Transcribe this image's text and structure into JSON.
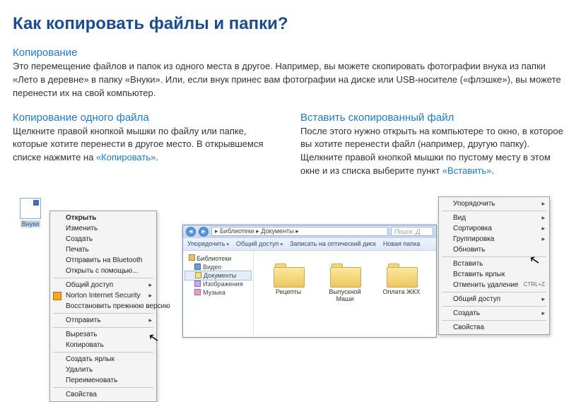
{
  "title": "Как копировать файлы и папки?",
  "section_copy": {
    "head": "Копирование",
    "p1": "Это перемещение файлов и папок из одного места в другое. Например, вы можете скопировать фотографии внука из папки «Лето в деревне» в папку «Внуки». Или, если внук принес вам фотографии на диске или USB-носителе («флэшке»), вы можете перенести их на свой компьютер."
  },
  "section_one": {
    "head": "Копирование одного файла",
    "p_before": "Щелкните правой кнопкой мышки по файлу или папке, которые хотите перенести в другое место. В открывшемся списке нажмите на ",
    "link": "«Копировать»",
    "p_after": "."
  },
  "section_paste": {
    "head": "Вставить скопированный файл",
    "p_before": "После этого нужно открыть на компьютере то окно, в которое вы хотите перенести файл (например, другую папку). Щелкните правой кнопкой мышки по пустому месту в этом окне и из списка выберите пункт ",
    "link": "«Вставить»",
    "p_after": "."
  },
  "fig1": {
    "icon_label": "Внуки",
    "menu": {
      "open": "Открыть",
      "edit": "Изменить",
      "create": "Создать",
      "print": "Печать",
      "bluetooth": "Отправить на Bluetooth",
      "openwith": "Открыть с помощью...",
      "share": "Общий доступ",
      "norton": "Norton Internet Security",
      "restore": "Восстановить прежнюю версию",
      "send": "Отправить",
      "cut": "Вырезать",
      "copy": "Копировать",
      "shortcut": "Создать ярлык",
      "delete": "Удалить",
      "rename": "Переименовать",
      "props": "Свойства"
    }
  },
  "fig2": {
    "breadcrumb": "▸ Библиотеки ▸ Документы ▸",
    "search_placeholder": "Поиск: Д",
    "toolbar": {
      "organize": "Упорядочить",
      "share": "Общий доступ",
      "burn": "Записать на оптический диск",
      "newfolder": "Новая папка"
    },
    "side": {
      "libs": "Библиотеки",
      "video": "Видео",
      "docs": "Документы",
      "images": "Изображения",
      "music": "Музыка"
    },
    "folders": {
      "f1": "Рецепты",
      "f2": "Выпускной Маши",
      "f3": "Оплата ЖКХ"
    },
    "menu": {
      "organize": "Упорядочить",
      "view": "Вид",
      "sort": "Сортировка",
      "group": "Группировка",
      "refresh": "Обновить",
      "paste": "Вставить",
      "paste_shortcut": "Вставить ярлык",
      "undo": "Отменить удаление",
      "undo_key": "CTRL+Z",
      "share": "Общий доступ",
      "create": "Создать",
      "props": "Свойства"
    }
  }
}
